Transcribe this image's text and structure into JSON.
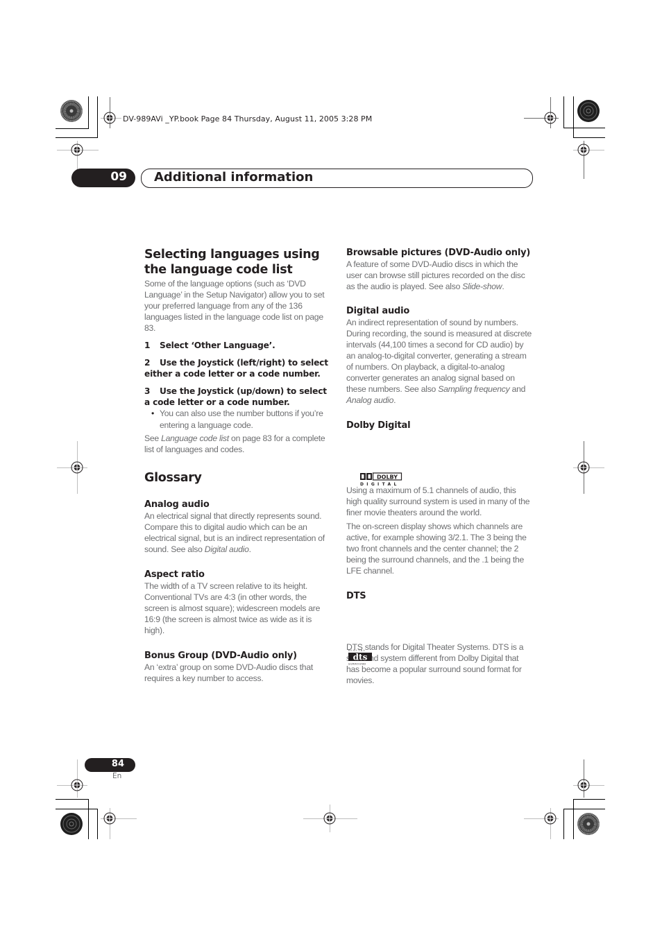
{
  "print_header": {
    "book_info": "DV-989AVi _YP.book  Page 84  Thursday, August 11, 2005  3:28 PM"
  },
  "chapter": {
    "number": "09",
    "title": "Additional information"
  },
  "left_column": {
    "section_title": "Selecting languages using the language code list",
    "intro": "Some of the language options (such as ‘DVD Language’ in the Setup Navigator) allow you to set your preferred language from any of the 136 languages listed in the language code list on page 83.",
    "steps": [
      {
        "num": "1",
        "text": "Select ‘Other Language’."
      },
      {
        "num": "2",
        "text": "Use the Joystick (left/right) to select either a code letter or a code number."
      },
      {
        "num": "3",
        "text": "Use the Joystick (up/down) to select a code letter or a code number."
      }
    ],
    "bullet": "You can also use the number buttons if you’re entering a language code.",
    "see_also": {
      "prefix": "See ",
      "link": "Language code list",
      "suffix": " on page 83 for a complete list of languages and codes."
    },
    "glossary_title": "Glossary",
    "terms": [
      {
        "term": "Analog audio",
        "text": "An electrical signal that directly represents sound. Compare this to digital audio which can be an electrical signal, but is an indirect representation of sound. See also ",
        "ref": "Digital audio",
        "end": "."
      },
      {
        "term": "Aspect ratio",
        "text": "The width of a TV screen relative to its height. Conventional TVs are 4:3 (in other words, the screen is almost square); widescreen models are 16:9 (the screen is almost twice as wide as it is high)."
      },
      {
        "term": "Bonus Group (DVD-Audio only)",
        "text": "An ‘extra’ group on some DVD-Audio discs that requires a key number to access."
      }
    ]
  },
  "right_column": {
    "terms": [
      {
        "term": "Browsable pictures (DVD-Audio only)",
        "text": "A feature of some DVD-Audio discs in which the user can browse still pictures recorded on the disc as the audio is played. See also ",
        "ref": "Slide-show",
        "end": "."
      },
      {
        "term": "Digital audio",
        "text": "An indirect representation of sound by numbers. During recording, the sound is measured at discrete intervals (44,100 times a second for CD audio) by an analog-to-digital converter, generating a stream of numbers. On playback, a digital-to-analog converter generates an analog signal based on these numbers. See also ",
        "ref1": "Sampling frequency",
        "mid": " and ",
        "ref2": "Analog audio",
        "end": "."
      },
      {
        "term": "Dolby Digital",
        "logo": {
          "mark": "DOLBY",
          "sub": "D I G I T A L"
        },
        "paragraphs": [
          "Using a maximum of 5.1 channels of audio, this high quality surround system is used in many of the finer movie theaters around the world.",
          "The on-screen display shows which channels are active, for example showing 3/2.1. The 3 being the two front channels and the center channel; the 2 being the surround channels, and the .1 being the LFE channel."
        ]
      },
      {
        "term": "DTS",
        "logo": {
          "top": "DIGITAL",
          "mark": "dts",
          "bottom": "SURROUND"
        },
        "text": "DTS stands for Digital Theater Systems. DTS is a surround system different from Dolby Digital that has become a popular surround sound format for movies."
      }
    ]
  },
  "footer": {
    "page_number": "84",
    "language": "En"
  }
}
